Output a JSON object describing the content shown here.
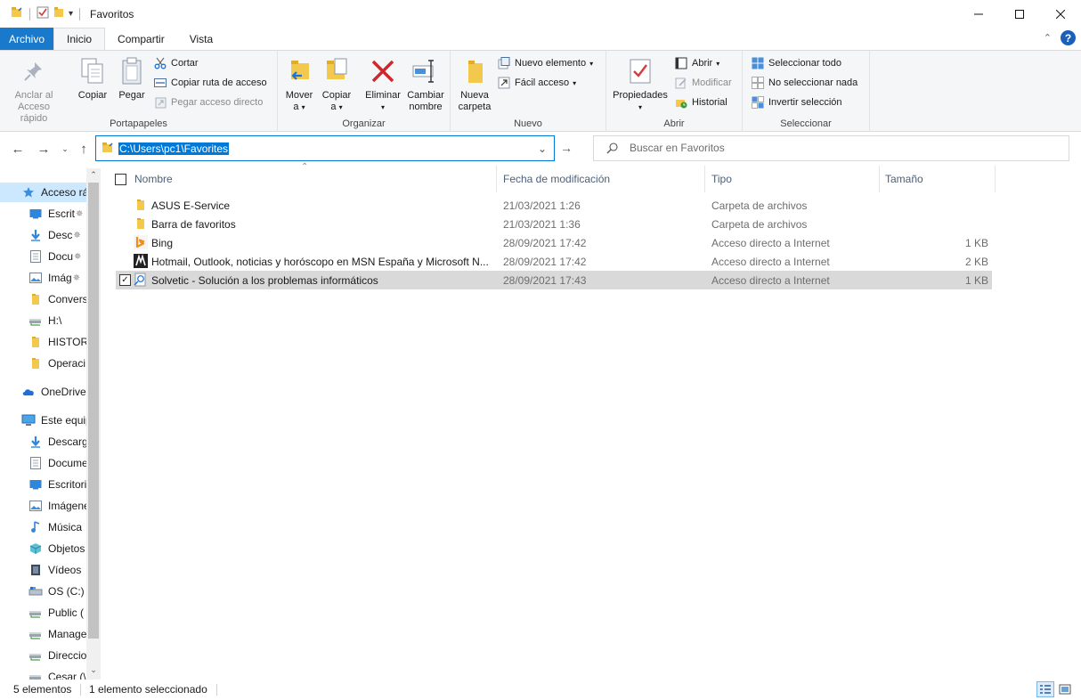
{
  "window": {
    "title": "Favoritos"
  },
  "ribbon_tabs": [
    "Archivo",
    "Inicio",
    "Compartir",
    "Vista"
  ],
  "ribbon": {
    "portapapeles": {
      "label": "Portapapeles",
      "pin_line1": "Anclar al",
      "pin_line2": "Acceso rápido",
      "copy": "Copiar",
      "paste": "Pegar",
      "cut": "Cortar",
      "copy_path": "Copiar ruta de acceso",
      "paste_shortcut": "Pegar acceso directo"
    },
    "organizar": {
      "label": "Organizar",
      "move_line1": "Mover",
      "move_line2": "a",
      "copy_line1": "Copiar",
      "copy_line2": "a",
      "delete": "Eliminar",
      "rename_line1": "Cambiar",
      "rename_line2": "nombre"
    },
    "nuevo": {
      "label": "Nuevo",
      "folder_line1": "Nueva",
      "folder_line2": "carpeta",
      "new_item": "Nuevo elemento",
      "easy_access": "Fácil acceso"
    },
    "abrir": {
      "label": "Abrir",
      "properties": "Propiedades",
      "open": "Abrir",
      "edit": "Modificar",
      "history": "Historial"
    },
    "seleccionar": {
      "label": "Seleccionar",
      "select_all": "Seleccionar todo",
      "select_none": "No seleccionar nada",
      "invert": "Invertir selección"
    }
  },
  "address": {
    "path": "C:\\Users\\pc1\\Favorites",
    "search_placeholder": "Buscar en Favoritos"
  },
  "nav_pane": {
    "items": [
      {
        "label": "Acceso rá",
        "icon": "star-icon",
        "pinned": false
      },
      {
        "label": "Escrit",
        "icon": "desktop-icon",
        "pinned": true
      },
      {
        "label": "Desc",
        "icon": "download-icon",
        "pinned": true
      },
      {
        "label": "Docu",
        "icon": "document-icon",
        "pinned": true
      },
      {
        "label": "Imág",
        "icon": "picture-icon",
        "pinned": true
      },
      {
        "label": "Convers",
        "icon": "folder-icon",
        "pinned": false
      },
      {
        "label": "H:\\",
        "icon": "network-drive-icon",
        "pinned": false
      },
      {
        "label": "HISTORI",
        "icon": "folder-icon",
        "pinned": false
      },
      {
        "label": "Operaci",
        "icon": "folder-icon",
        "pinned": false
      },
      {
        "label": "OneDrive",
        "icon": "cloud-icon",
        "pinned": false
      },
      {
        "label": "Este equip",
        "icon": "computer-icon",
        "pinned": false
      },
      {
        "label": "Descarg",
        "icon": "download-icon",
        "pinned": false
      },
      {
        "label": "Docume",
        "icon": "document-icon",
        "pinned": false
      },
      {
        "label": "Escritori",
        "icon": "desktop-icon",
        "pinned": false
      },
      {
        "label": "Imágene",
        "icon": "picture-icon",
        "pinned": false
      },
      {
        "label": "Música",
        "icon": "music-icon",
        "pinned": false
      },
      {
        "label": "Objetos",
        "icon": "cube-icon",
        "pinned": false
      },
      {
        "label": "Vídeos",
        "icon": "video-icon",
        "pinned": false
      },
      {
        "label": "OS (C:)",
        "icon": "os-drive-icon",
        "pinned": false
      },
      {
        "label": "Public (",
        "icon": "network-drive-icon",
        "pinned": false
      },
      {
        "label": "Manage",
        "icon": "network-drive-icon",
        "pinned": false
      },
      {
        "label": "Direccio",
        "icon": "network-drive-icon",
        "pinned": false
      },
      {
        "label": "Cesar (\\",
        "icon": "network-drive-icon",
        "pinned": false
      }
    ]
  },
  "file_list": {
    "columns": [
      "Nombre",
      "Fecha de modificación",
      "Tipo",
      "Tamaño"
    ],
    "rows": [
      {
        "name": "ASUS E-Service",
        "date": "21/03/2021 1:26",
        "type": "Carpeta de archivos",
        "size": "",
        "icon": "folder-icon",
        "selected": false
      },
      {
        "name": "Barra de favoritos",
        "date": "21/03/2021 1:36",
        "type": "Carpeta de archivos",
        "size": "",
        "icon": "folder-icon",
        "selected": false
      },
      {
        "name": "Bing",
        "date": "28/09/2021 17:42",
        "type": "Acceso directo a Internet",
        "size": "1 KB",
        "icon": "bing-icon",
        "selected": false
      },
      {
        "name": "Hotmail, Outlook, noticias y horóscopo en MSN España y Microsoft N...",
        "date": "28/09/2021 17:42",
        "type": "Acceso directo a Internet",
        "size": "2 KB",
        "icon": "msn-icon",
        "selected": false
      },
      {
        "name": "Solvetic - Solución a los problemas informáticos",
        "date": "28/09/2021 17:43",
        "type": "Acceso directo a Internet",
        "size": "1 KB",
        "icon": "internet-shortcut-icon",
        "selected": true
      }
    ]
  },
  "status": {
    "count": "5 elementos",
    "selection": "1 elemento seleccionado"
  },
  "colors": {
    "accent": "#0078d7",
    "file_tab": "#1979ca",
    "ribbon_bg": "#f5f6f7",
    "selected_row": "#d9d9d9",
    "folder": "#f2c94c"
  }
}
